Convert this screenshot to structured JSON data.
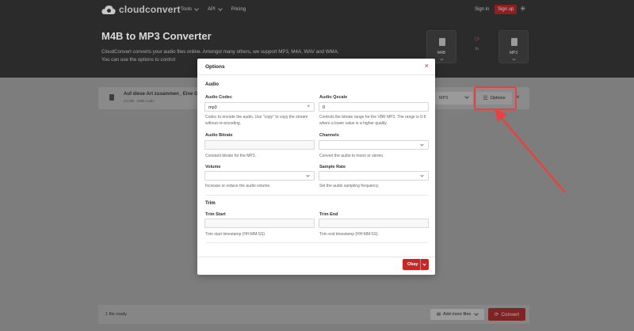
{
  "header": {
    "brand": "cloudconvert",
    "nav": [
      "Tools",
      "API",
      "Pricing"
    ],
    "signin": "Sign in",
    "signup": "Sign up",
    "settings_icon": "gear-icon"
  },
  "hero": {
    "title": "M4B to MP3 Converter",
    "description": "CloudConvert converts your audio files online. Amongst many others, we support MP3, M4A, WAV and WMA. You can use the options to control",
    "from_format": "M4B",
    "to_label": "to",
    "to_format": "MP3"
  },
  "file": {
    "name": "Auf diese Art zusammen_ Eine Ge",
    "meta": "44 MB · M4B Audio",
    "format": "MP3",
    "options_label": "Options"
  },
  "bottom": {
    "ready_text": "1 file ready",
    "add_more": "Add more files",
    "convert": "Convert"
  },
  "modal": {
    "title": "Options",
    "audio_section": "Audio",
    "audio_codec": {
      "label": "Audio Codec",
      "value": "mp3",
      "help": "Codec to encode the audio. Use \"copy\" to copy the stream without re-encoding."
    },
    "audio_qscale": {
      "label": "Audio Qscale",
      "value": "0",
      "help": "Controls the bitrate range for the VBR MP3. The range is 0-9 where a lower value is a higher quality."
    },
    "audio_bitrate": {
      "label": "Audio Bitrate",
      "value": "",
      "help": "Constant bitrate for the MP3."
    },
    "channels": {
      "label": "Channels",
      "value": "",
      "help": "Convert the audio to mono or stereo."
    },
    "volume": {
      "label": "Volume",
      "value": "",
      "help": "Increase or reduce the audio volume."
    },
    "sample_rate": {
      "label": "Sample Rate",
      "value": "",
      "help": "Set the audio sampling frequency."
    },
    "trim_section": "Trim",
    "trim_start": {
      "label": "Trim Start",
      "value": "",
      "help": "Trim start timestamp (HH:MM:SS)"
    },
    "trim_end": {
      "label": "Trim End",
      "value": "",
      "help": "Trim end timestamp (HH:MM:SS)"
    },
    "okay": "Okay"
  },
  "colors": {
    "accent": "#c62828",
    "annotation": "#e8423f"
  }
}
